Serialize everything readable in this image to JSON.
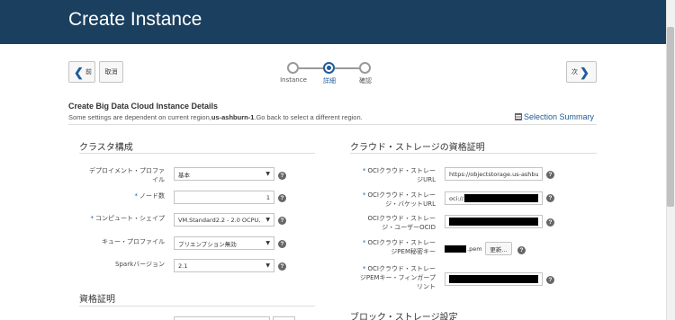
{
  "header": {
    "title": "Create Instance"
  },
  "nav": {
    "back_label": "前",
    "cancel_label": "取消",
    "next_label": "次"
  },
  "train": {
    "steps": [
      {
        "label": "Instance",
        "state": "done"
      },
      {
        "label": "詳細",
        "state": "active"
      },
      {
        "label": "確認",
        "state": "pending"
      }
    ]
  },
  "page": {
    "title": "Create Big Data Cloud Instance Details",
    "subtitle_pre": "Some settings are dependent on current region,",
    "subtitle_region": "us-ashburn-1",
    "subtitle_post": ".Go back to select a different region.",
    "selection_summary": "Selection Summary"
  },
  "cluster": {
    "heading": "クラスタ構成",
    "deployment_profile": {
      "label_l1": "デプロイメント・プロファ",
      "label_l2": "イル",
      "value": "基本"
    },
    "node_count": {
      "label": "ノード数",
      "value": "1"
    },
    "compute_shape": {
      "label": "コンピュート・シェイプ",
      "value": "VM.Standard2.2 - 2.0 OCPU, 3"
    },
    "queue_profile": {
      "label": "キュー・プロファイル",
      "value": "プリエンプション無効"
    },
    "spark_version": {
      "label": "Sparkバージョン",
      "value": "2.1"
    }
  },
  "credentials": {
    "heading": "資格証明"
  },
  "cloud_storage": {
    "heading": "クラウド・ストレージの資格証明",
    "storage_url": {
      "label_l1": "OCIクラウド・ストレー",
      "label_l2": "ジURL",
      "value": "https://objectstorage.us-ashburn-"
    },
    "bucket_url": {
      "label_l1": "OCIクラウド・ストレー",
      "label_l2": "ジ・バケットURL",
      "value": "oci://"
    },
    "user_ocid": {
      "label_l1": "OCIクラウド・ストレー",
      "label_l2": "ジ・ユーザーOCID"
    },
    "pem_key": {
      "label_l1": "OCIクラウド・ストレー",
      "label_l2": "ジPEM秘密キー",
      "file_ext": ".pem",
      "update_label": "更新..."
    },
    "fingerprint": {
      "label_l1": "OCIクラウド・ストレー",
      "label_l2": "ジPEMキー・フィンガープ",
      "label_l3": "リント"
    }
  },
  "block_storage": {
    "heading": "ブロック・ストレージ設定"
  },
  "icons": {
    "back": "chevron-left-icon",
    "next": "chevron-right-icon",
    "help": "question-icon",
    "summary": "grid-icon"
  },
  "colors": {
    "header_bg": "#1b3f5e",
    "accent": "#1f5c99"
  }
}
